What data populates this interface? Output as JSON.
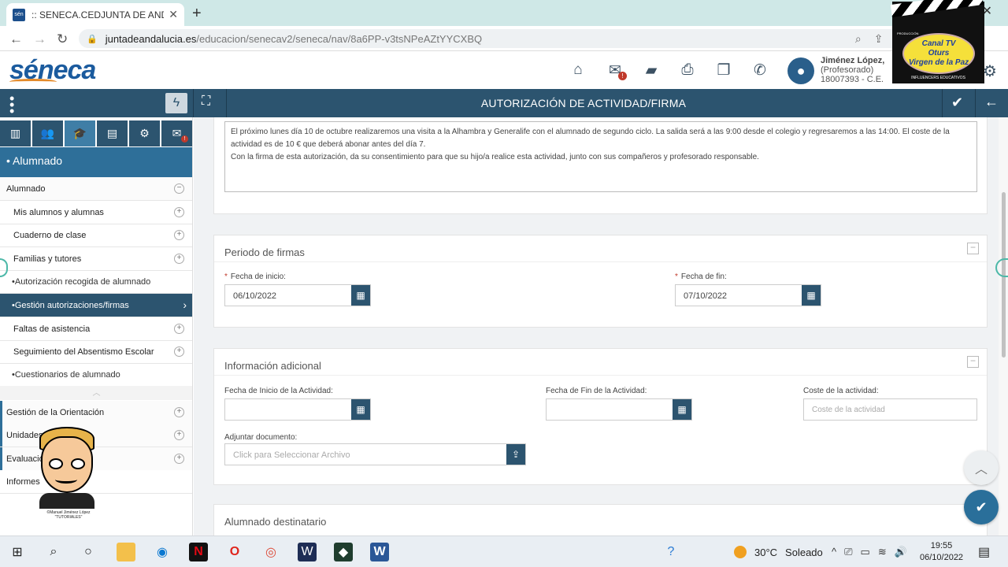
{
  "browser": {
    "tab_title": ":: SENECA.CEDJUNTA DE ANDALUCÍA",
    "tab_favicon": "sén",
    "url_host": "juntadeandalucia.es",
    "url_path": "/educacion/senecav2/seneca/nav/8a6PP-v3tsNPeAZtYYCXBQ"
  },
  "header": {
    "logo": "séneca",
    "user_name": "Jiménez López, ",
    "user_role": "(Profesorado)",
    "user_code": "18007393 - C.E.",
    "icons": [
      "home-icon",
      "mail-icon",
      "folder-icon",
      "print-icon",
      "copy-icon",
      "phone-icon"
    ],
    "mail_badge": "!"
  },
  "toolbar": {
    "title": "AUTORIZACIÓN DE ACTIVIDAD/FIRMA"
  },
  "sidebar": {
    "heading": "• Alumnado",
    "items": [
      {
        "label": "Alumnado",
        "kind": "group-open"
      },
      {
        "label": "Mis alumnos y alumnas",
        "kind": "item"
      },
      {
        "label": "Cuaderno de clase",
        "kind": "item"
      },
      {
        "label": "Familias y tutores",
        "kind": "item"
      },
      {
        "label": "•Autorización recogida de alumnado",
        "kind": "sub"
      },
      {
        "label": "•Gestión autorizaciones/firmas",
        "kind": "active"
      },
      {
        "label": "Faltas de asistencia",
        "kind": "item"
      },
      {
        "label": "Seguimiento del Absentismo Escolar",
        "kind": "item"
      },
      {
        "label": "•Cuestionarios de alumnado",
        "kind": "sub"
      }
    ],
    "groups": [
      {
        "label": "Gestión de la Orientación"
      },
      {
        "label": "Unidades"
      },
      {
        "label": "Evaluación"
      },
      {
        "label": "Informes"
      }
    ],
    "mascot_caption_1": "©Manuel Jiménez López",
    "mascot_caption_2": "\"TUTORIALES\""
  },
  "main": {
    "description_text": "El próximo lunes día 10 de octubre realizaremos una visita a la Alhambra y Generalife con el alumnado de segundo ciclo. La salida será a las 9:00 desde el colegio y regresaremos a las 14:00. El coste de la actividad es de 10 € que deberá abonar antes del día 7.",
    "description_text_2": "Con la firma de esta autorización, da su consentimiento para que su hijo/a realice esta actividad, junto con sus compañeros y profesorado responsable.",
    "periodo": {
      "title": "Periodo de firmas",
      "start_label": "Fecha de inicio:",
      "start_value": "06/10/2022",
      "end_label": "Fecha de fin:",
      "end_value": "07/10/2022"
    },
    "adicional": {
      "title": "Información adicional",
      "start_label": "Fecha de Inicio de la Actividad:",
      "end_label": "Fecha de Fin de la Actividad:",
      "cost_label": "Coste de la actividad:",
      "cost_placeholder": "Coste de la actividad",
      "attach_label": "Adjuntar documento:",
      "attach_placeholder": "Click para Seleccionar Archivo"
    },
    "destinatario": {
      "title": "Alumnado destinatario"
    }
  },
  "overlay": {
    "channel_line1": "Canal TV",
    "channel_line2": "Oturs",
    "channel_line3": "Virgen de la Paz",
    "producer": "PRODUCCIÓN",
    "footer": "INFLUENCERS EDUCATIVOS"
  },
  "taskbar": {
    "temperature": "30°C",
    "weather": "Soleado",
    "time": "19:55",
    "date": "06/10/2022"
  }
}
